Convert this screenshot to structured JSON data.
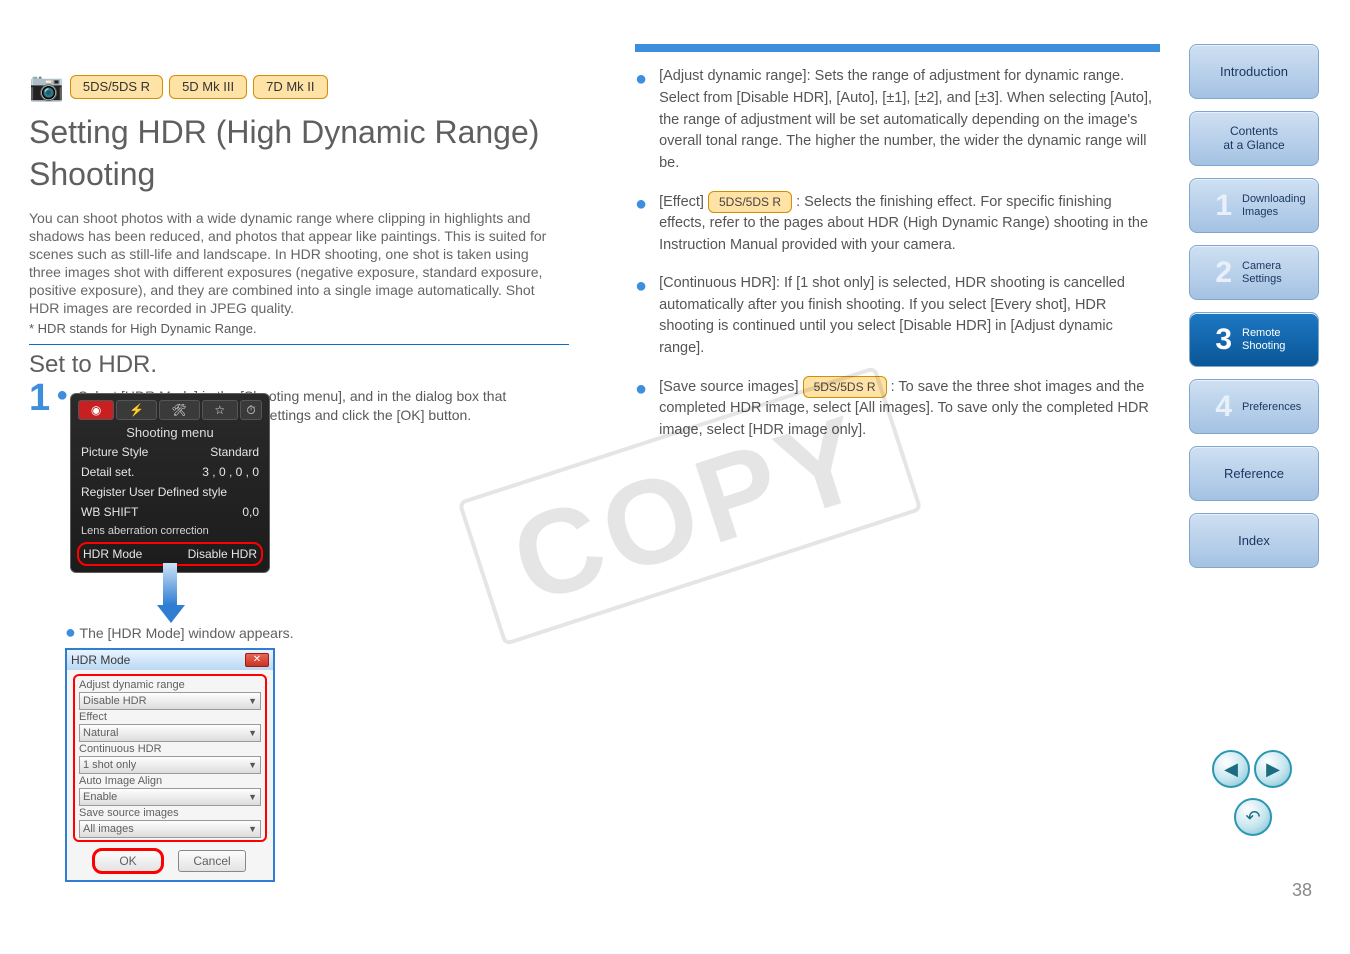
{
  "header": {
    "pill_a": "5DS/5DS R",
    "pill_b": "5D Mk III",
    "pill_c": "7D Mk II"
  },
  "section": {
    "title_line1": "Setting HDR (High Dynamic Range)",
    "title_line2": "Shooting",
    "intro": "You can shoot photos with a wide dynamic range where clipping in highlights and shadows has been reduced, and photos that appear like paintings. This is suited for scenes such as still-life and landscape. In HDR shooting, one shot is taken using three images shot with different exposures (negative exposure, standard exposure, positive exposure), and they are combined into a single image automatically. Shot HDR images are recorded in JPEG quality.",
    "hdr_note": "* HDR stands for High Dynamic Range.",
    "heading": "Set to HDR.",
    "step": {
      "number": "1",
      "bullet": "Select [HDR Mode] in the [Shooting menu], and in the dialog box that appears, specify the required settings and click the [OK] button.",
      "result": "The [HDR Mode] window appears."
    }
  },
  "shooting_menu": {
    "label": "Shooting menu",
    "rows": [
      {
        "name": "Picture Style",
        "value": "Standard"
      },
      {
        "name": "Detail set.",
        "value": "3 , 0 , 0 , 0"
      },
      {
        "name": "Register User Defined style",
        "value": ""
      },
      {
        "name": "WB SHIFT",
        "value": "0,0"
      },
      {
        "name": "Lens aberration correction",
        "value": ""
      },
      {
        "name": "HDR Mode",
        "value": "Disable HDR"
      }
    ]
  },
  "hdr_dialog": {
    "title": "HDR Mode",
    "fields": {
      "adjust_label": "Adjust dynamic range",
      "adjust_value": "Disable HDR",
      "effect_label": "Effect",
      "effect_value": "Natural",
      "cont_label": "Continuous HDR",
      "cont_value": "1 shot only",
      "align_label": "Auto Image Align",
      "align_value": "Enable",
      "save_label": "Save source images",
      "save_value": "All images"
    },
    "ok": "OK",
    "cancel": "Cancel"
  },
  "right_col": {
    "b1": "[Adjust dynamic range]: Sets the range of adjustment for dynamic range. Select from [Disable HDR], [Auto], [±1], [±2], and [±3]. When selecting [Auto], the range of adjustment will be set automatically depending on the image's overall tonal range. The higher the number, the wider the dynamic range will be.",
    "b2_pre": "[Effect] ",
    "b2_pill": "5DS/5DS R",
    "b2_post": " : Selects the finishing effect. For specific finishing effects, refer to the pages about HDR (High Dynamic Range) shooting in the Instruction Manual provided with your camera.",
    "b3": "[Continuous HDR]: If [1 shot only] is selected, HDR shooting is cancelled automatically after you finish shooting. If you select [Every shot], HDR shooting is continued until you select [Disable HDR] in [Adjust dynamic range].",
    "b4_pre": "[Save source images] ",
    "b4_pill": "5DS/5DS R",
    "b4_post": " : To save the three shot images and the completed HDR image, select [All images]. To save only the completed HDR image, select [HDR image only]."
  },
  "nav": {
    "t1a": "Introduction",
    "t2a": "Contents",
    "t2b": "at a Glance",
    "n1_left": "1",
    "n1_label1": "Downloading",
    "n1_label2": "Images",
    "n2_left": "2",
    "n2_label1": "Camera",
    "n2_label2": "Settings",
    "n3_left": "3",
    "n3_label1": "Remote",
    "n3_label2": "Shooting",
    "n4_left": "4",
    "n4_label1": "Preferences",
    "t5": "Reference",
    "t6": "Index"
  },
  "footer": {
    "page": "38",
    "watermark": "COPY"
  }
}
